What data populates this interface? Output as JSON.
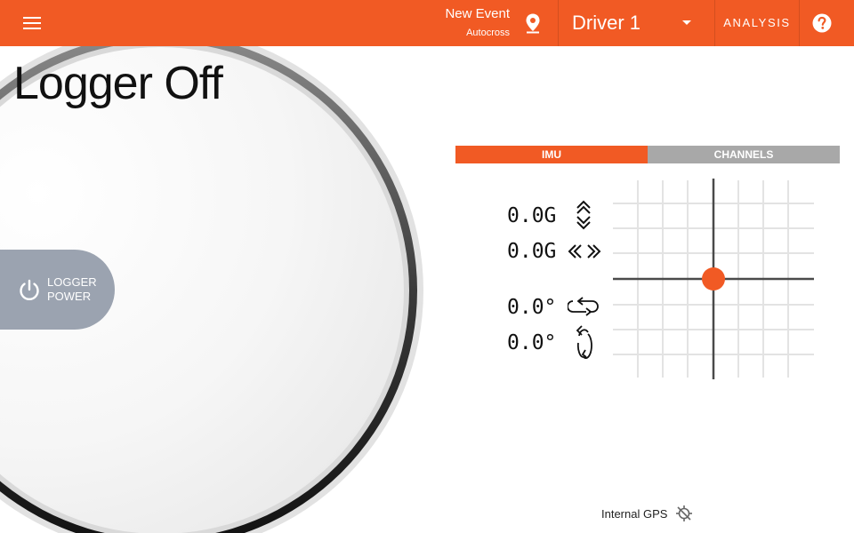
{
  "header": {
    "event_name": "New Event",
    "event_type": "Autocross",
    "driver": "Driver 1",
    "analysis_label": "ANALYSIS",
    "icons": {
      "menu": "hamburger-menu-icon",
      "location": "map-pin-icon",
      "driver_dropdown": "caret-down-icon",
      "help": "help-circle-icon"
    },
    "color": "#f15a24"
  },
  "logger": {
    "status": "Logger Off",
    "power_button_label_line1": "LOGGER",
    "power_button_label_line2": "POWER",
    "power_icon": "power-icon",
    "button_color": "#9ba3b0"
  },
  "tabs": [
    {
      "label": "IMU",
      "active": true,
      "color": "#f15a24"
    },
    {
      "label": "CHANNELS",
      "active": false,
      "color": "#a8a8a8"
    }
  ],
  "imu": {
    "readings": [
      {
        "value": "0.0G",
        "icon": "vertical-accel-icon"
      },
      {
        "value": "0.0G",
        "icon": "lateral-accel-icon"
      },
      {
        "value": "0.0°",
        "icon": "yaw-rotation-icon"
      },
      {
        "value": "0.0°",
        "icon": "roll-rotation-icon"
      }
    ],
    "plot_dot_color": "#f15a24"
  },
  "gps": {
    "label": "Internal GPS",
    "icon": "gps-off-icon"
  }
}
